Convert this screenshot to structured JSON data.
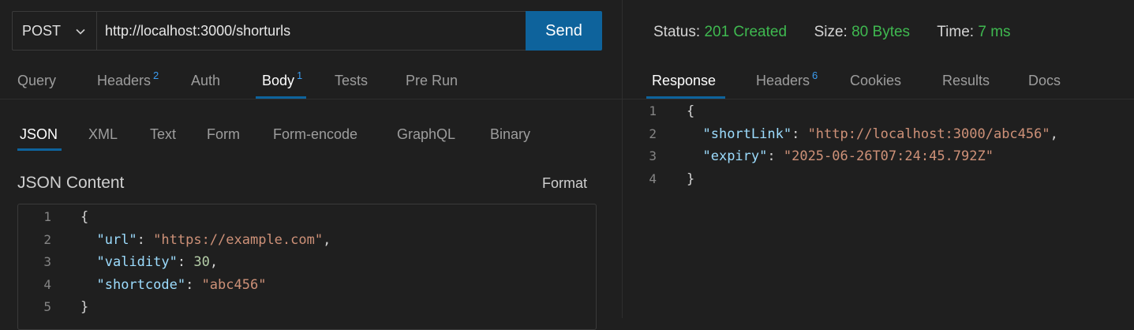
{
  "request": {
    "method": "POST",
    "url": "http://localhost:3000/shorturls",
    "send_label": "Send",
    "tabs": [
      {
        "label": "Query"
      },
      {
        "label": "Headers",
        "badge": "2"
      },
      {
        "label": "Auth"
      },
      {
        "label": "Body",
        "badge": "1",
        "active": true
      },
      {
        "label": "Tests"
      },
      {
        "label": "Pre Run"
      }
    ],
    "body_types": [
      "JSON",
      "XML",
      "Text",
      "Form",
      "Form-encode",
      "GraphQL",
      "Binary"
    ],
    "section_title": "JSON Content",
    "format_label": "Format",
    "line_numbers": [
      "1",
      "2",
      "3",
      "4",
      "5"
    ],
    "body_lines": {
      "l1": "{",
      "l2_key": "\"url\"",
      "l2_sep": ": ",
      "l2_val": "\"https://example.com\"",
      "l2_end": ",",
      "l3_key": "\"validity\"",
      "l3_sep": ": ",
      "l3_val": "30",
      "l3_end": ",",
      "l4_key": "\"shortcode\"",
      "l4_sep": ": ",
      "l4_val": "\"abc456\"",
      "l5": "}"
    }
  },
  "response": {
    "status_label": "Status:",
    "status_value": "201 Created",
    "size_label": "Size:",
    "size_value": "80 Bytes",
    "time_label": "Time:",
    "time_value": "7 ms",
    "tabs": [
      {
        "label": "Response",
        "active": true
      },
      {
        "label": "Headers",
        "badge": "6"
      },
      {
        "label": "Cookies"
      },
      {
        "label": "Results"
      },
      {
        "label": "Docs"
      }
    ],
    "line_numbers": [
      "1",
      "2",
      "3",
      "4"
    ],
    "body_lines": {
      "l1": "{",
      "l2_key": "\"shortLink\"",
      "l2_sep": ": ",
      "l2_val": "\"http://localhost:3000/abc456\"",
      "l2_end": ",",
      "l3_key": "\"expiry\"",
      "l3_sep": ": ",
      "l3_val": "\"2025-06-26T07:24:45.792Z\"",
      "l4": "}"
    }
  },
  "colors": {
    "accent": "#0e639c",
    "success": "#3fb950",
    "badge": "#3b9cf0"
  }
}
